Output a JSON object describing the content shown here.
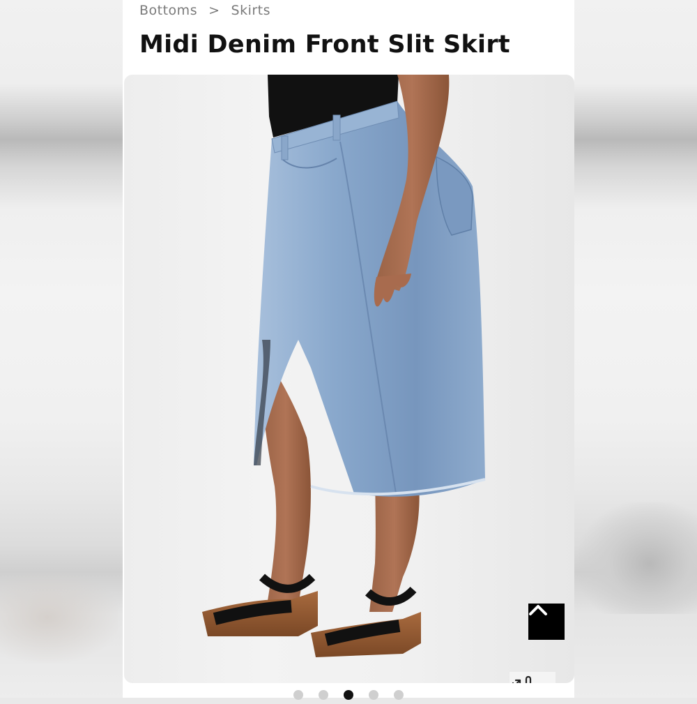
{
  "breadcrumb": {
    "items": [
      "Bottoms",
      "Skirts"
    ],
    "separator": ">"
  },
  "product": {
    "title": "Midi Denim Front Slit Skirt"
  },
  "gallery": {
    "image": "Product photo: person wearing a light-wash denim midi skirt with a front slit, black top and black strap platform sandals",
    "slide_count": 5,
    "active_slide": 3
  },
  "icons": {
    "scroll_top": "chevron-up-icon",
    "zoom": "pinch-zoom-hand-icon"
  },
  "colors": {
    "page_bg": "#ffffff",
    "title": "#111111",
    "breadcrumb": "#7a7a7a",
    "denim": "#7f9fc4",
    "button_bg": "#000000"
  }
}
